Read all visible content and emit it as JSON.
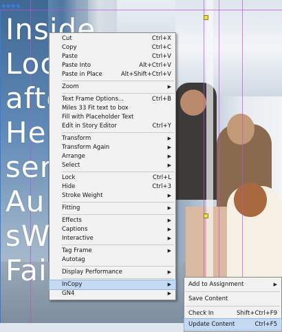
{
  "headline": [
    "Inside",
    "Loc",
    "afte",
    "Her",
    "ser",
    "Au",
    "sW",
    "Fairs"
  ],
  "frame_anchor_label": "◆◆◆◆",
  "context_menu": {
    "items": [
      {
        "label": "Cut",
        "shortcut": "Ctrl+X"
      },
      {
        "label": "Copy",
        "shortcut": "Ctrl+C"
      },
      {
        "label": "Paste",
        "shortcut": "Ctrl+V"
      },
      {
        "label": "Paste Into",
        "shortcut": "Alt+Ctrl+V"
      },
      {
        "label": "Paste in Place",
        "shortcut": "Alt+Shift+Ctrl+V"
      },
      {
        "label": "Zoom",
        "submenu": true
      },
      {
        "label": "Text Frame Options...",
        "shortcut": "Ctrl+B"
      },
      {
        "label": "Miles 33 Fit text to box"
      },
      {
        "label": "Fill with Placeholder Text"
      },
      {
        "label": "Edit in Story Editor",
        "shortcut": "Ctrl+Y"
      },
      {
        "label": "Transform",
        "submenu": true
      },
      {
        "label": "Transform Again",
        "submenu": true
      },
      {
        "label": "Arrange",
        "submenu": true
      },
      {
        "label": "Select",
        "submenu": true
      },
      {
        "label": "Lock",
        "shortcut": "Ctrl+L"
      },
      {
        "label": "Hide",
        "shortcut": "Ctrl+3"
      },
      {
        "label": "Stroke Weight",
        "submenu": true
      },
      {
        "label": "Fitting",
        "submenu": true
      },
      {
        "label": "Effects",
        "submenu": true
      },
      {
        "label": "Captions",
        "submenu": true
      },
      {
        "label": "Interactive",
        "submenu": true
      },
      {
        "label": "Tag Frame",
        "submenu": true
      },
      {
        "label": "Autotag"
      },
      {
        "label": "Display Performance",
        "submenu": true
      },
      {
        "label": "InCopy",
        "submenu": true
      },
      {
        "label": "GN4",
        "submenu": true
      }
    ]
  },
  "incopy_submenu": {
    "items": [
      {
        "label": "Add to Assignment",
        "submenu": true
      },
      {
        "label": "Save Content"
      },
      {
        "label": "Check In",
        "shortcut": "Shift+Ctrl+F9"
      },
      {
        "label": "Update Content",
        "shortcut": "Ctrl+F5"
      }
    ]
  },
  "colors": {
    "menu_bg": "#f2f2f2",
    "highlight": "#c4daf3",
    "guide": "#c04fd9",
    "frame": "#3b7ad8"
  }
}
